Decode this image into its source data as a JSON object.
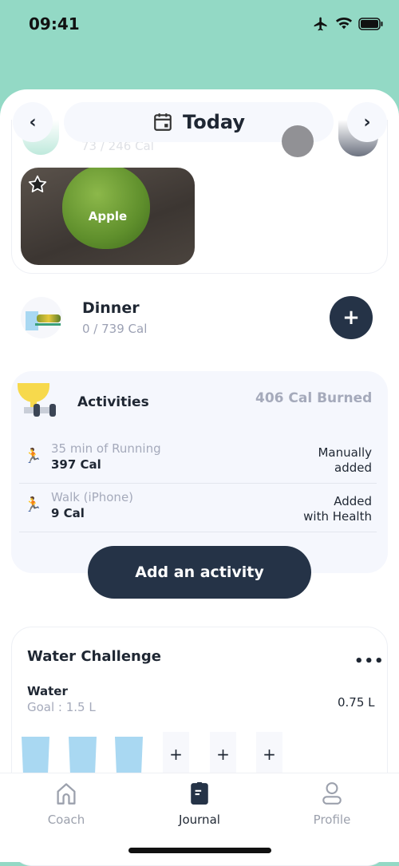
{
  "status_bar": {
    "time": "09:41",
    "icons": [
      "airplane-icon",
      "wifi-icon",
      "battery-icon"
    ]
  },
  "date_nav": {
    "label": "Today",
    "prev": "‹",
    "next": "›"
  },
  "meal_card": {
    "faded_calories": "73 / 246 Cal",
    "food_item": {
      "name": "Apple",
      "favorite_icon": "star-icon"
    }
  },
  "dinner": {
    "title": "Dinner",
    "calories": "0 / 739 Cal",
    "add": "+"
  },
  "activities": {
    "title": "Activities",
    "burned": "406 Cal Burned",
    "items": [
      {
        "name": "35 min of Running",
        "calories": "397 Cal",
        "source_line1": "Manually",
        "source_line2": "added"
      },
      {
        "name": "Walk (iPhone)",
        "calories": "9 Cal",
        "source_line1": "Added",
        "source_line2": "with Health"
      }
    ],
    "add_button": "Add an activity"
  },
  "water": {
    "title": "Water Challenge",
    "more": "•••",
    "label": "Water",
    "goal": "Goal : 1.5 L",
    "amount": "0.75 L",
    "filled_glasses": 3,
    "total_glasses_visible": 6,
    "plus": "+"
  },
  "tabs": [
    {
      "label": "Coach",
      "icon": "home-icon"
    },
    {
      "label": "Journal",
      "icon": "journal-icon",
      "active": true
    },
    {
      "label": "Profile",
      "icon": "profile-icon"
    }
  ],
  "colors": {
    "header": "#93d9c5",
    "accent_dark": "#253347",
    "water": "#a9d8f2"
  }
}
